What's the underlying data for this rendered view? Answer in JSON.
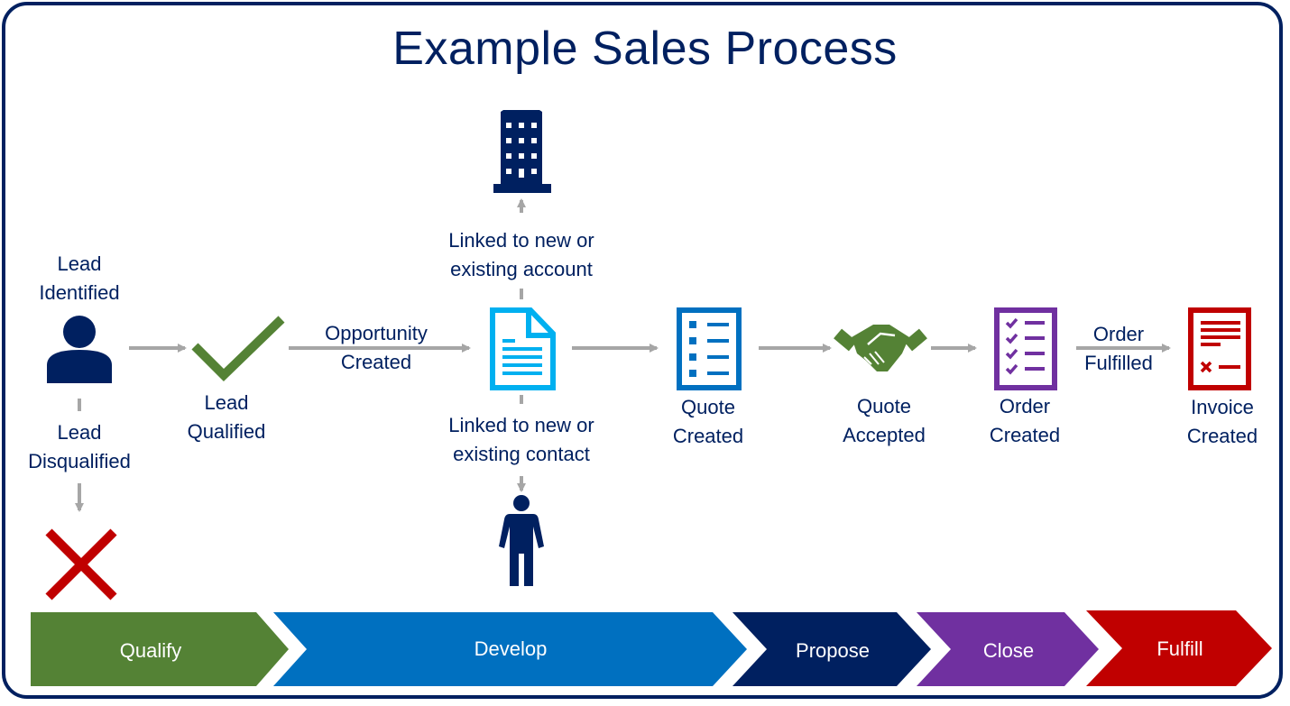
{
  "title": "Example Sales Process",
  "colors": {
    "navy": "#002060",
    "green": "#548235",
    "blue": "#0070C0",
    "light_blue": "#00B0F0",
    "purple": "#7030A0",
    "red": "#C00000",
    "arrow_gray": "#A6A6A6"
  },
  "steps": {
    "lead_identified": "Lead\nIdentified",
    "lead_disqualified": "Lead\nDisqualified",
    "lead_qualified": "Lead\nQualified",
    "opportunity_created": "Opportunity\nCreated",
    "linked_account": "Linked to new or\nexisting account",
    "linked_contact": "Linked to new or\nexisting contact",
    "quote_created": "Quote\nCreated",
    "quote_accepted": "Quote\nAccepted",
    "order_created": "Order\nCreated",
    "order_fulfilled": "Order\nFulfilled",
    "invoice_created": "Invoice\nCreated"
  },
  "stages": [
    {
      "label": "Qualify",
      "color": "#548235"
    },
    {
      "label": "Develop",
      "color": "#0070C0"
    },
    {
      "label": "Propose",
      "color": "#002060"
    },
    {
      "label": "Close",
      "color": "#7030A0"
    },
    {
      "label": "Fulfill",
      "color": "#C00000"
    }
  ],
  "icons": {
    "lead": "person-bust-icon",
    "disqualified": "x-mark-icon",
    "qualified": "checkmark-icon",
    "opportunity": "document-icon",
    "account": "building-icon",
    "contact": "person-standing-icon",
    "quote": "list-icon",
    "accepted": "handshake-icon",
    "order": "checklist-icon",
    "invoice": "invoice-icon"
  }
}
